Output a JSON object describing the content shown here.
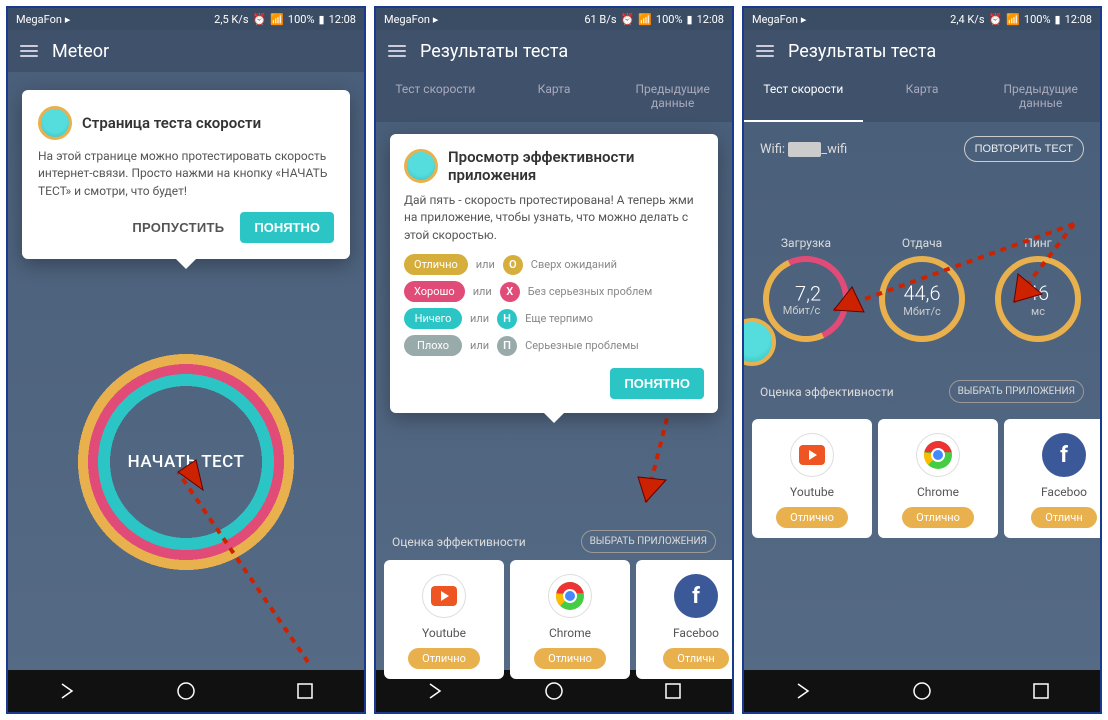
{
  "status": {
    "carrier": "MegaFon",
    "speeds": [
      "2,5 K/s",
      "61 B/s",
      "2,4 K/s"
    ],
    "battery": "100%",
    "time": "12:08"
  },
  "screen1": {
    "header_title": "Meteor",
    "popup": {
      "title": "Страница теста скорости",
      "body": "На этой странице можно протестировать скорость интернет-связи. Просто нажми на кнопку «НАЧАТЬ ТЕСТ» и смотри, что будет!",
      "skip": "ПРОПУСТИТЬ",
      "ok": "ПОНЯТНО"
    },
    "start_btn": "НАЧАТЬ ТЕСТ"
  },
  "screen2": {
    "header_title": "Результаты теста",
    "tabs": [
      "Тест скорости",
      "Карта",
      "Предыдущие данные"
    ],
    "popup": {
      "title": "Просмотр эффективности приложения",
      "body": "Дай пять - скорость протестирована! А теперь жми на приложение, чтобы узнать, что можно делать с этой скоростью.",
      "ratings": [
        {
          "label": "Отлично",
          "or": "или",
          "letter": "О",
          "desc": "Сверх ожиданий",
          "cls": "green"
        },
        {
          "label": "Хорошо",
          "or": "или",
          "letter": "Х",
          "desc": "Без серьезных проблем",
          "cls": "pink"
        },
        {
          "label": "Ничего",
          "or": "или",
          "letter": "Н",
          "desc": "Еще терпимо",
          "cls": "teal"
        },
        {
          "label": "Плохо",
          "or": "или",
          "letter": "П",
          "desc": "Серьезные проблемы",
          "cls": "grey"
        }
      ],
      "ok": "ПОНЯТНО"
    },
    "eval_label": "Оценка эффективности",
    "pick_apps": "ВЫБРАТЬ ПРИЛОЖЕНИЯ"
  },
  "screen3": {
    "header_title": "Результаты теста",
    "tabs": [
      "Тест скорости",
      "Карта",
      "Предыдущие данные"
    ],
    "wifi_label": "Wifi:",
    "wifi_name": "_wifi",
    "repeat": "ПОВТОРИТЬ ТЕСТ",
    "metrics": [
      {
        "label": "Загрузка",
        "value": "7,2",
        "unit": "Мбит/с",
        "style": "partial"
      },
      {
        "label": "Отдача",
        "value": "44,6",
        "unit": "Мбит/с",
        "style": "full"
      },
      {
        "label": "Пинг",
        "value": "46",
        "unit": "мс",
        "style": "full"
      }
    ],
    "eval_label": "Оценка эффективности",
    "pick_apps": "ВЫБРАТЬ ПРИЛОЖЕНИЯ"
  },
  "apps": [
    {
      "name": "Youtube",
      "rating": "Отлично",
      "icon": "yt"
    },
    {
      "name": "Chrome",
      "rating": "Отлично",
      "icon": "chrome"
    },
    {
      "name": "Faceboo",
      "rating": "Отличн",
      "icon": "fb"
    }
  ]
}
